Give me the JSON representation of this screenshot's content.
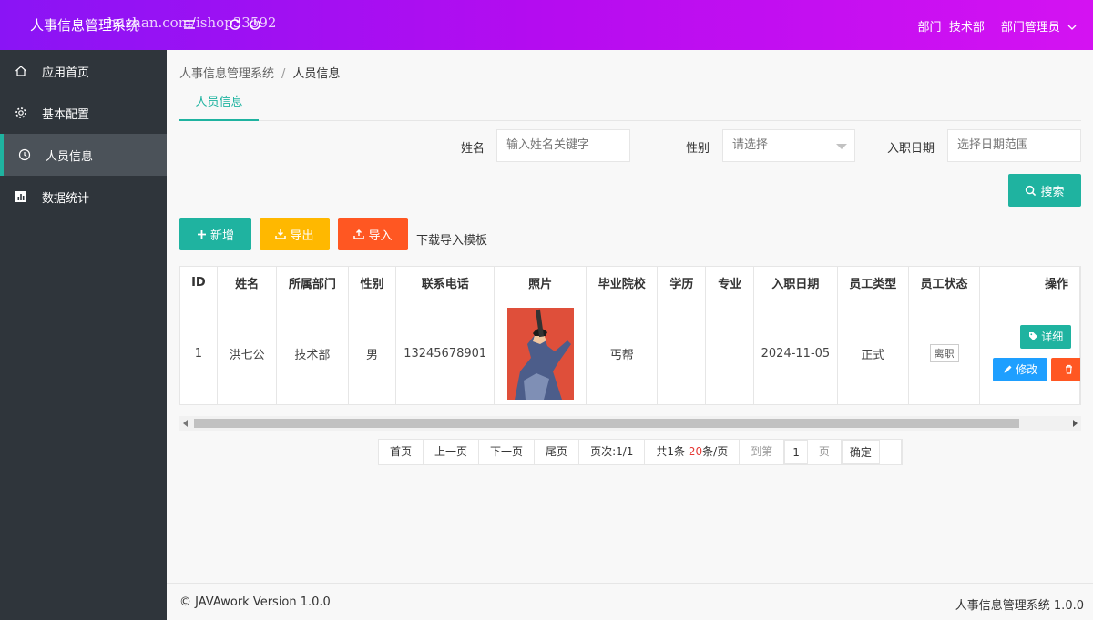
{
  "header": {
    "app_title": "人事信息管理系统",
    "watermark": "huzhan.com/ishop33592",
    "dept_label": "部门",
    "dept_value": "技术部",
    "user_role": "部门管理员",
    "gradient_colors": [
      "#8a14f5",
      "#d412f2"
    ]
  },
  "sidebar": {
    "items": [
      {
        "label": "应用首页",
        "icon": "home-icon"
      },
      {
        "label": "基本配置",
        "icon": "gear-icon"
      },
      {
        "label": "人员信息",
        "icon": "clock-icon",
        "active": true
      },
      {
        "label": "数据统计",
        "icon": "bar-chart-icon"
      }
    ]
  },
  "breadcrumb": {
    "root": "人事信息管理系统",
    "sep": "/",
    "current": "人员信息"
  },
  "tab": {
    "label": "人员信息"
  },
  "filters": {
    "name_label": "姓名",
    "name_placeholder": "输入姓名关键字",
    "gender_label": "性别",
    "gender_placeholder": "请选择",
    "date_label": "入职日期",
    "date_placeholder": "选择日期范围",
    "search_label": "搜索"
  },
  "toolbar": {
    "add_label": "新增",
    "export_label": "导出",
    "import_label": "导入",
    "template_label": "下载导入模板"
  },
  "table": {
    "headers": [
      "ID",
      "姓名",
      "所属部门",
      "性别",
      "联系电话",
      "照片",
      "毕业院校",
      "学历",
      "专业",
      "入职日期",
      "员工类型",
      "员工状态",
      "操作"
    ],
    "rows": [
      {
        "id": "1",
        "name": "洪七公",
        "dept": "技术部",
        "gender": "男",
        "phone": "13245678901",
        "school": "丐帮",
        "education": "",
        "major": "",
        "hire_date": "2024-11-05",
        "type": "正式",
        "status": "离职"
      }
    ],
    "actions": {
      "detail": "详细",
      "edit": "修改"
    }
  },
  "pager": {
    "first": "首页",
    "prev": "上一页",
    "next": "下一页",
    "last": "尾页",
    "page_info_prefix": "页次:",
    "page_info_value": "1/1",
    "total_prefix": "共1条",
    "per_page_value": "20",
    "per_page_suffix": "条/页",
    "goto_label": "到第",
    "page_input": "1",
    "page_unit": "页",
    "confirm": "确定"
  },
  "footer": {
    "left": "© JAVAwork Version 1.0.0",
    "right": "人事信息管理系统 1.0.0"
  },
  "colors": {
    "accent": "#1fb3a0",
    "warning": "#ffb800",
    "danger": "#ff5722",
    "info": "#1e9fff",
    "sidebar": "#2f353b"
  }
}
